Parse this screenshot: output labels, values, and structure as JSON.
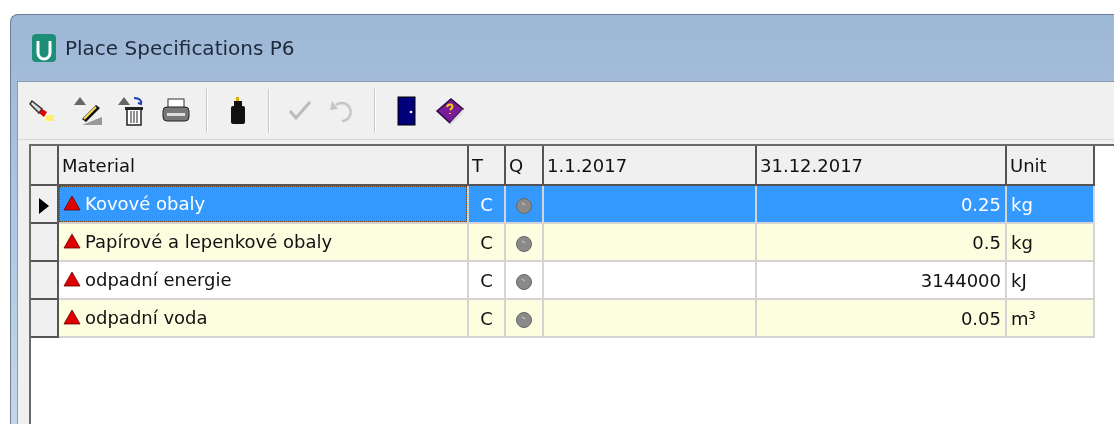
{
  "window": {
    "title": "Place Specifications P6"
  },
  "toolbar": [
    {
      "kind": "flashlight",
      "disabled": false
    },
    {
      "kind": "edit",
      "disabled": false
    },
    {
      "kind": "delete",
      "disabled": false
    },
    {
      "kind": "print",
      "disabled": false
    },
    {
      "kind": "separator"
    },
    {
      "kind": "bottle",
      "disabled": false
    },
    {
      "kind": "separator"
    },
    {
      "kind": "check",
      "disabled": true
    },
    {
      "kind": "undo",
      "disabled": true
    },
    {
      "kind": "separator"
    },
    {
      "kind": "door",
      "disabled": false
    },
    {
      "kind": "help-book",
      "disabled": false
    }
  ],
  "table": {
    "columns": [
      "Material",
      "T",
      "Q",
      "1.1.2017",
      "31.12.2017",
      "Unit"
    ],
    "rows": [
      {
        "selected": true,
        "material": "Kovové obaly",
        "t": "C",
        "value_2": "0.25",
        "unit": "kg"
      },
      {
        "selected": false,
        "material": "Papírové a lepenkové obaly",
        "t": "C",
        "value_2": "0.5",
        "unit": "kg"
      },
      {
        "selected": false,
        "material": "odpadní energie",
        "t": "C",
        "value_2": "3144000",
        "unit": "kJ"
      },
      {
        "selected": false,
        "material": "odpadní voda",
        "t": "C",
        "value_2": "0.05",
        "unit": "m³"
      }
    ]
  }
}
